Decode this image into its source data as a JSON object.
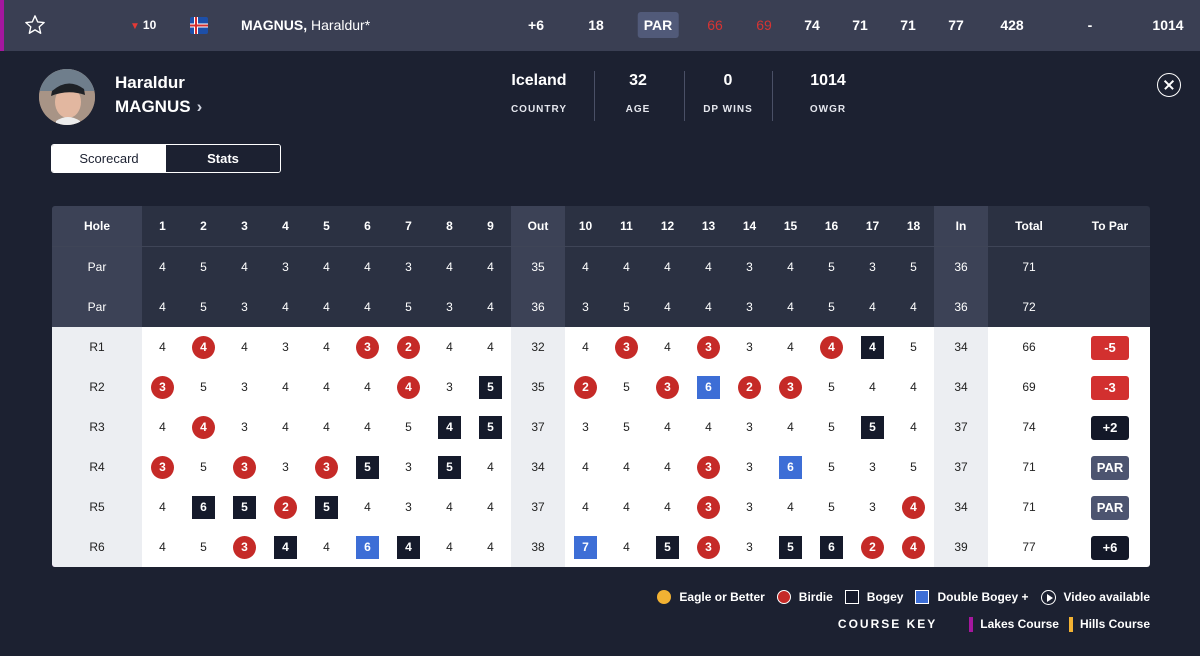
{
  "leaderboard_row": {
    "movement": "10",
    "movement_direction": "down",
    "name_last": "MAGNUS,",
    "name_first": "Haraldur*",
    "to_par": "+6",
    "thru": "18",
    "today": "PAR",
    "r1": "66",
    "r2": "69",
    "r3": "74",
    "r4": "71",
    "r5": "71",
    "r6": "77",
    "total": "428",
    "points": "-",
    "owgr": "1014"
  },
  "player": {
    "first_name": "Haraldur",
    "last_name": "MAGNUS",
    "chevron": "›",
    "stats": [
      {
        "value": "Iceland",
        "label": "COUNTRY"
      },
      {
        "value": "32",
        "label": "AGE"
      },
      {
        "value": "0",
        "label": "DP WINS"
      },
      {
        "value": "1014",
        "label": "OWGR"
      }
    ]
  },
  "tabs": [
    {
      "label": "Scorecard",
      "active": true
    },
    {
      "label": "Stats",
      "active": false
    }
  ],
  "scorecard": {
    "header": [
      "Hole",
      "1",
      "2",
      "3",
      "4",
      "5",
      "6",
      "7",
      "8",
      "9",
      "Out",
      "10",
      "11",
      "12",
      "13",
      "14",
      "15",
      "16",
      "17",
      "18",
      "In",
      "Total",
      "To Par"
    ],
    "par_rows": [
      {
        "label": "Par",
        "course": "lakes",
        "holes": [
          4,
          5,
          4,
          3,
          4,
          4,
          3,
          4,
          4,
          4,
          4,
          4,
          4,
          3,
          4,
          5,
          3,
          5
        ],
        "out": "35",
        "in": "36",
        "total": "71"
      },
      {
        "label": "Par",
        "course": "hills",
        "holes": [
          4,
          5,
          3,
          4,
          4,
          4,
          5,
          3,
          4,
          3,
          5,
          4,
          4,
          3,
          4,
          5,
          4,
          4
        ],
        "out": "36",
        "in": "36",
        "total": "72"
      }
    ],
    "rounds": [
      {
        "label": "R1",
        "course": "lakes",
        "scores": [
          4,
          4,
          4,
          3,
          4,
          3,
          2,
          4,
          4,
          4,
          3,
          4,
          3,
          3,
          4,
          4,
          4,
          5
        ],
        "types": [
          "",
          "b",
          "",
          "",
          "",
          "b",
          "b",
          "",
          "",
          "",
          "b",
          "",
          "b",
          "",
          "",
          "b",
          "g",
          ""
        ],
        "out": "32",
        "in": "34",
        "total": "66",
        "to_par": "-5",
        "to_par_type": "under"
      },
      {
        "label": "R2",
        "course": "hills",
        "scores": [
          3,
          5,
          3,
          4,
          4,
          4,
          4,
          3,
          5,
          2,
          5,
          3,
          6,
          2,
          3,
          5,
          4,
          4
        ],
        "types": [
          "b",
          "",
          "",
          "",
          "",
          "",
          "b",
          "",
          "g",
          "b",
          "",
          "b",
          "d",
          "b",
          "b",
          "",
          "",
          ""
        ],
        "out": "35",
        "in": "34",
        "total": "69",
        "to_par": "-3",
        "to_par_type": "under"
      },
      {
        "label": "R3",
        "course": "hills",
        "scores": [
          4,
          4,
          3,
          4,
          4,
          4,
          5,
          4,
          5,
          3,
          5,
          4,
          4,
          3,
          4,
          5,
          5,
          4
        ],
        "types": [
          "",
          "b",
          "",
          "",
          "",
          "",
          "",
          "g",
          "g",
          "",
          "",
          "",
          "",
          "",
          "",
          "",
          "g",
          ""
        ],
        "out": "37",
        "in": "37",
        "total": "74",
        "to_par": "+2",
        "to_par_type": "over"
      },
      {
        "label": "R4",
        "course": "lakes",
        "scores": [
          3,
          5,
          3,
          3,
          3,
          5,
          3,
          5,
          4,
          4,
          4,
          4,
          3,
          3,
          6,
          5,
          3,
          5
        ],
        "types": [
          "b",
          "",
          "b",
          "",
          "b",
          "g",
          "",
          "g",
          "",
          "",
          "",
          "",
          "b",
          "",
          "d",
          "",
          "",
          ""
        ],
        "out": "34",
        "in": "37",
        "total": "71",
        "to_par": "PAR",
        "to_par_type": "even"
      },
      {
        "label": "R5",
        "course": "lakes",
        "scores": [
          4,
          6,
          5,
          2,
          5,
          4,
          3,
          4,
          4,
          4,
          4,
          4,
          3,
          3,
          4,
          5,
          3,
          4
        ],
        "types": [
          "",
          "g",
          "g",
          "b",
          "g",
          "",
          "",
          "",
          "",
          "",
          "",
          "",
          "b",
          "",
          "",
          "",
          "",
          "b"
        ],
        "out": "37",
        "in": "34",
        "total": "71",
        "to_par": "PAR",
        "to_par_type": "even"
      },
      {
        "label": "R6",
        "course": "lakes",
        "scores": [
          4,
          5,
          3,
          4,
          4,
          6,
          4,
          4,
          4,
          7,
          4,
          5,
          3,
          3,
          5,
          6,
          2,
          4
        ],
        "types": [
          "",
          "",
          "b",
          "g",
          "",
          "d",
          "g",
          "",
          "",
          "d",
          "",
          "g",
          "b",
          "",
          "g",
          "g",
          "b",
          "b"
        ],
        "out": "38",
        "in": "39",
        "total": "77",
        "to_par": "+6",
        "to_par_type": "over"
      }
    ]
  },
  "legend": [
    {
      "label": "Eagle or Better",
      "type": "eagle"
    },
    {
      "label": "Birdie",
      "type": "birdie"
    },
    {
      "label": "Bogey",
      "type": "bogey"
    },
    {
      "label": "Double Bogey +",
      "type": "dbl"
    },
    {
      "label": "Video available",
      "type": "video"
    }
  ],
  "course_key": {
    "title": "COURSE KEY",
    "courses": [
      {
        "label": "Lakes Course",
        "color": "#a5179e"
      },
      {
        "label": "Hills Course",
        "color": "#f2b233"
      }
    ]
  },
  "colors": {
    "lakes": "#a5179e",
    "hills": "#f2b233",
    "birdie": "#c52a27",
    "bogey": "#151a2b",
    "double_bogey": "#3d6ed6"
  }
}
